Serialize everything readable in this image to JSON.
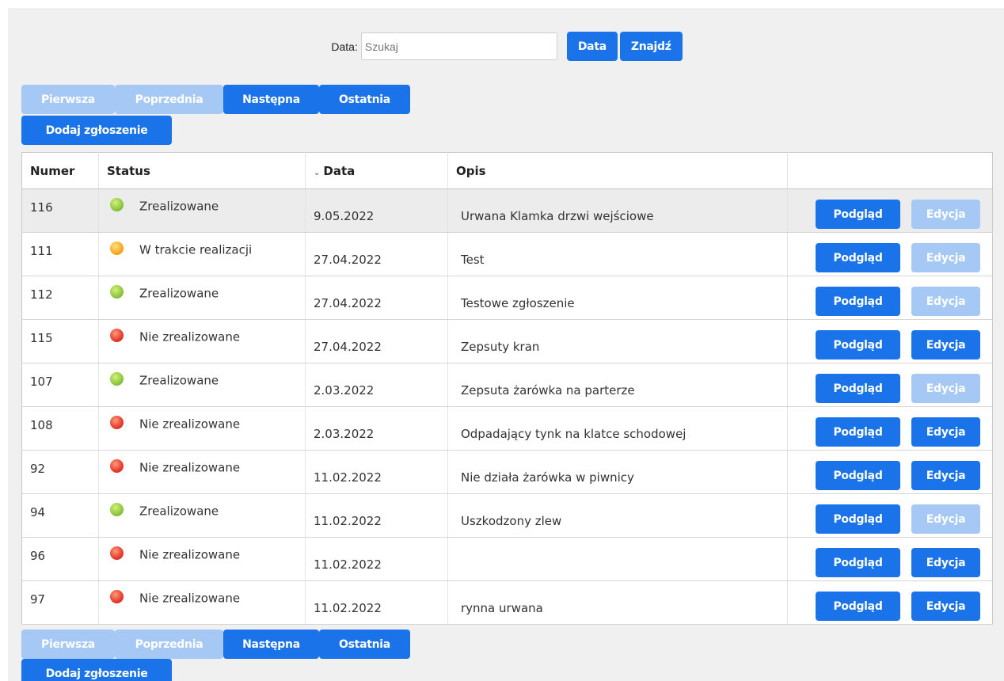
{
  "search": {
    "label": "Data:",
    "placeholder": "Szukaj",
    "date_button": "Data",
    "find_button": "Znajdź"
  },
  "pager": {
    "first": "Pierwsza",
    "prev": "Poprzednia",
    "next": "Następna",
    "last": "Ostatnia",
    "first_enabled": false,
    "prev_enabled": false
  },
  "add_button": "Dodaj zgłoszenie",
  "table": {
    "headers": {
      "numer": "Numer",
      "status": "Status",
      "data": "Data",
      "opis": "Opis",
      "actions": ""
    },
    "sort_icon": "sort-desc-icon",
    "preview_label": "Podgląd",
    "edit_label": "Edycja",
    "rows": [
      {
        "numer": "116",
        "status": "Zrealizowane",
        "status_color": "green",
        "data": "9.05.2022",
        "opis": "Urwana Klamka drzwi wejściowe",
        "edit_enabled": false
      },
      {
        "numer": "111",
        "status": "W trakcie realizacji",
        "status_color": "orange",
        "data": "27.04.2022",
        "opis": "Test",
        "edit_enabled": false
      },
      {
        "numer": "112",
        "status": "Zrealizowane",
        "status_color": "green",
        "data": "27.04.2022",
        "opis": "Testowe zgłoszenie",
        "edit_enabled": false
      },
      {
        "numer": "115",
        "status": "Nie zrealizowane",
        "status_color": "red",
        "data": "27.04.2022",
        "opis": "Zepsuty kran",
        "edit_enabled": true
      },
      {
        "numer": "107",
        "status": "Zrealizowane",
        "status_color": "green",
        "data": "2.03.2022",
        "opis": "Zepsuta żarówka na parterze",
        "edit_enabled": false
      },
      {
        "numer": "108",
        "status": "Nie zrealizowane",
        "status_color": "red",
        "data": "2.03.2022",
        "opis": "Odpadający tynk na klatce schodowej",
        "edit_enabled": true
      },
      {
        "numer": "92",
        "status": "Nie zrealizowane",
        "status_color": "red",
        "data": "11.02.2022",
        "opis": "Nie działa żarówka w piwnicy",
        "edit_enabled": true
      },
      {
        "numer": "94",
        "status": "Zrealizowane",
        "status_color": "green",
        "data": "11.02.2022",
        "opis": "Uszkodzony zlew",
        "edit_enabled": false
      },
      {
        "numer": "96",
        "status": "Nie zrealizowane",
        "status_color": "red",
        "data": "11.02.2022",
        "opis": "",
        "edit_enabled": true
      },
      {
        "numer": "97",
        "status": "Nie zrealizowane",
        "status_color": "red",
        "data": "11.02.2022",
        "opis": "rynna urwana",
        "edit_enabled": true
      }
    ]
  },
  "colors": {
    "primary": "#1a73e8",
    "disabled": "#a5c8f4",
    "background": "#f0f0f0",
    "status_green": "#8cc63f",
    "status_orange": "#f7a81b",
    "status_red": "#e43b2d"
  }
}
